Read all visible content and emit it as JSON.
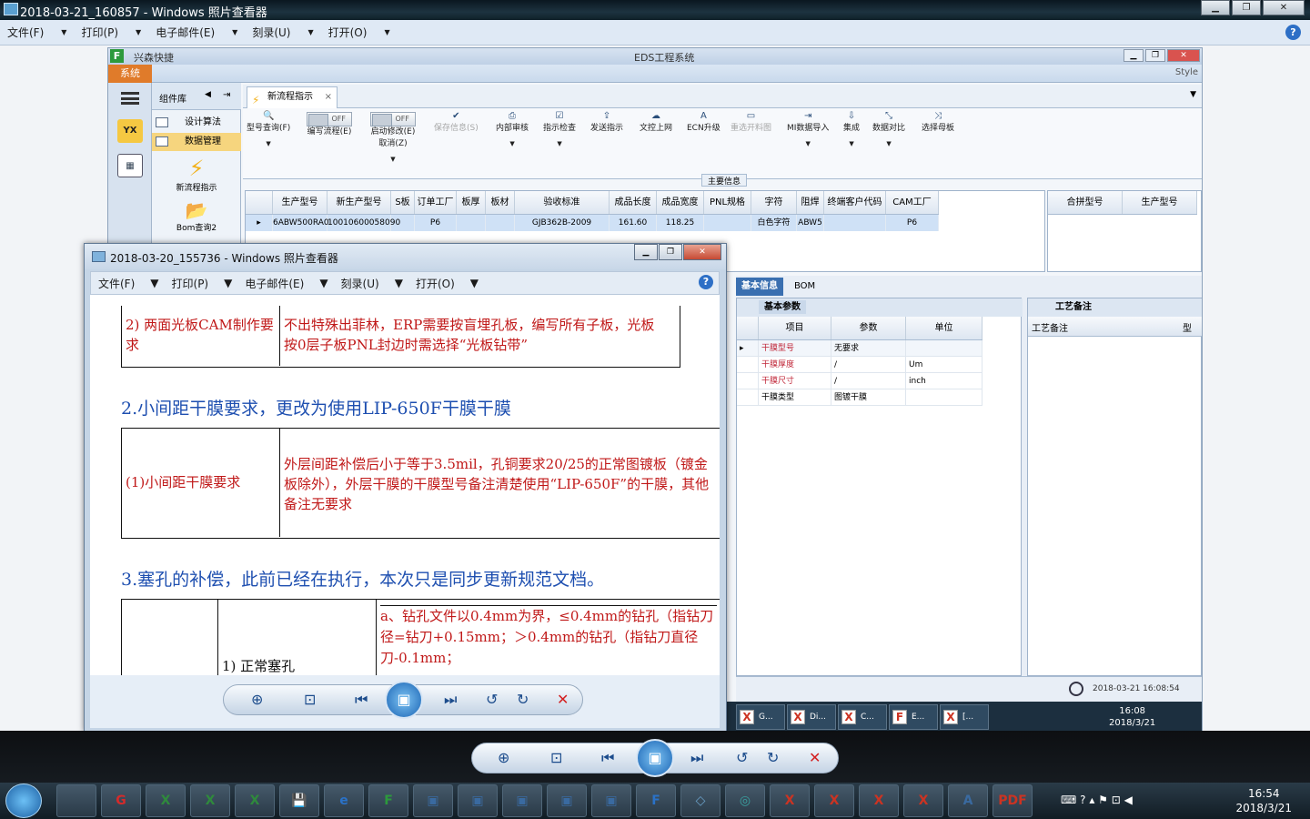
{
  "outer_window": {
    "title": "2018-03-21_160857 - Windows 照片查看器",
    "menu": [
      "文件(F)",
      "打印(P)",
      "电子邮件(E)",
      "刻录(U)",
      "打开(O)"
    ],
    "help": "?"
  },
  "eds": {
    "company": "兴森快捷",
    "title": "EDS工程系统",
    "system_tab": "系统",
    "style_label": "Style",
    "lib_title": "组件库",
    "lib_items": [
      "设计算法",
      "数据管理"
    ],
    "lib_tools": [
      "新流程指示",
      "Bom查询2"
    ],
    "left_icon_label": "YX",
    "tab_label": "新流程指示",
    "toolbar": [
      {
        "label": "型号查询(F)",
        "icon": "🔍",
        "dim": false
      },
      {
        "label": "编写流程(E)",
        "icon": "",
        "dim": false
      },
      {
        "label": "启动修改(E)\n取消(Z)",
        "icon": "",
        "dim": false
      },
      {
        "label": "保存信息(S)",
        "icon": "✔",
        "dim": true
      },
      {
        "label": "内部审核",
        "icon": "⎙",
        "dim": false
      },
      {
        "label": "指示检查",
        "icon": "☑",
        "dim": false
      },
      {
        "label": "发送指示",
        "icon": "⇪",
        "dim": false
      },
      {
        "label": "文控上网",
        "icon": "☁",
        "dim": false
      },
      {
        "label": "ECN升级",
        "icon": "A",
        "dim": false
      },
      {
        "label": "重选开料图",
        "icon": "▭",
        "dim": true
      },
      {
        "label": "MI数据导入",
        "icon": "⇥",
        "dim": false
      },
      {
        "label": "集成",
        "icon": "⇩",
        "dim": false
      },
      {
        "label": "数据对比",
        "icon": "⤡",
        "dim": false
      },
      {
        "label": "选择母板",
        "icon": "⤨",
        "dim": false
      }
    ],
    "toggle_off": "OFF",
    "main_info_label": "主要信息",
    "grid_headers": [
      "生产型号",
      "新生产型号",
      "S板",
      "订单工厂",
      "板厚",
      "板材",
      "验收标准",
      "成品长度",
      "成品宽度",
      "PNL规格",
      "字符",
      "阻焊",
      "终端客户代码",
      "CAM工厂"
    ],
    "grid_row": [
      "6ABW500RA0",
      "10010600058090",
      "",
      "P6",
      "",
      "",
      "GJB362B-2009",
      "161.60",
      "118.25",
      "",
      "白色字符",
      "ABW5",
      "",
      "P6"
    ],
    "grid2_headers": [
      "合拼型号",
      "生产型号"
    ],
    "lower_tabs": [
      "基本信息",
      "BOM"
    ],
    "basic_caption": "基本参数",
    "basic_headers": [
      "项目",
      "参数",
      "单位"
    ],
    "basic_rows": [
      {
        "item": "干膜型号",
        "param": "无要求",
        "unit": "",
        "red": true
      },
      {
        "item": "干膜厚度",
        "param": "/",
        "unit": "Um",
        "red": true
      },
      {
        "item": "干膜尺寸",
        "param": "/",
        "unit": "inch",
        "red": true
      },
      {
        "item": "干膜类型",
        "param": "图镀干膜",
        "unit": "",
        "red": false
      }
    ],
    "remark_caption": "工艺备注",
    "remark_header": "工艺备注",
    "remark_header2": "型",
    "status_datetime": "2018-03-21 16:08:54",
    "task_items": [
      "G...",
      "Di...",
      "C...",
      "E...",
      "[..."
    ],
    "task_time": "16:08",
    "task_date": "2018/3/21"
  },
  "inner_window": {
    "title": "2018-03-20_155736 - Windows 照片查看器",
    "menu": [
      "文件(F)",
      "打印(P)",
      "电子邮件(E)",
      "刻录(U)",
      "打开(O)"
    ],
    "help": "?"
  },
  "doc": {
    "row1_left": "2) 两面光板CAM制作要求",
    "row1_right": "不出特殊出菲林，ERP需要按盲埋孔板，编写所有子板，光板按0层子板PNL封边时需选择“光板钻带”",
    "heading2": "2.小间距干膜要求，更改为使用LIP-650F干膜干膜",
    "row2_left": "(1)小间距干膜要求",
    "row2_right": "外层间距补偿后小于等于3.5mil，孔铜要求20/25的正常图镀板（镀金板除外），外层干膜的干膜型号备注清楚使用“LIP-650F”的干膜，其他备注无要求",
    "heading3": "3.塞孔的补偿，此前已经在执行，本次只是同步更新规范文档。",
    "row3_mid": "1) 正常塞孔",
    "row3_right": "a、钻孔文件以0.4mm为界，≤0.4mm的钻孔（指钻刀径=钻刀+0.15mm；＞0.4mm的钻孔（指钻刀直径刀-0.1mm；"
  },
  "taskbar": {
    "time": "16:54",
    "date": "2018/3/21",
    "apps": [
      "",
      "G",
      "X",
      "X",
      "X",
      "💾",
      "e",
      "F",
      "▣",
      "▣",
      "▣",
      "▣",
      "▣",
      "F",
      "◇",
      "◎",
      "X",
      "X",
      "X",
      "X",
      "A",
      "PDF"
    ]
  },
  "colors": {
    "accent_red": "#c01818",
    "accent_blue": "#1e4fb0",
    "eds_orange": "#e07b2a"
  }
}
